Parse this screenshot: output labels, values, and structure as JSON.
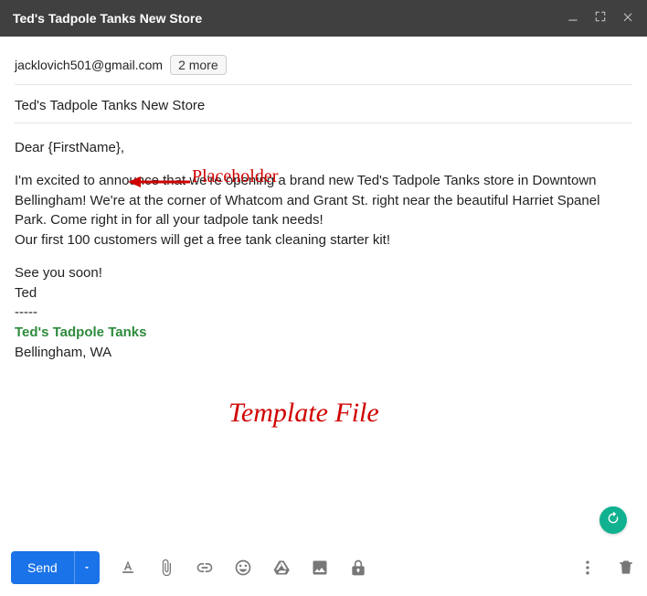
{
  "window": {
    "title": "Ted's Tadpole Tanks New Store"
  },
  "recipients": {
    "primary": "jacklovich501@gmail.com",
    "more_chip": "2 more"
  },
  "subject": "Ted's Tadpole Tanks New Store",
  "body": {
    "greeting": "Dear {FirstName},",
    "p1": "I'm excited to announce that we're opening a brand new Ted's Tadpole Tanks store in Downtown Bellingham! We're at the corner of Whatcom and Grant St. right near the beautiful Harriet Spanel Park. Come right in for all your tadpole tank needs!",
    "p2": "Our first 100 customers will get a free tank cleaning starter kit!",
    "signoff1": "See you soon!",
    "signoff2": "Ted",
    "divider": "-----",
    "sig_name": "Ted's Tadpole Tanks",
    "sig_loc": "Bellingham, WA"
  },
  "annotations": {
    "placeholder_label": "Placeholder",
    "template_label": "Template File"
  },
  "toolbar": {
    "send_label": "Send"
  }
}
